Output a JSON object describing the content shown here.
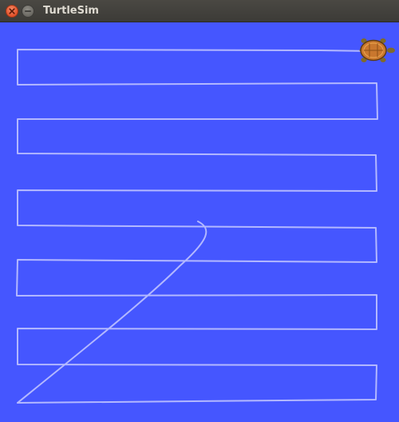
{
  "window": {
    "title": "TurtleSim"
  },
  "canvas": {
    "background_color": "#4556ff",
    "pen_color": "#b3b8ff",
    "turtle": {
      "name": "turtle-icon",
      "shell_color": "#c9772e",
      "pattern_color": "#e6a04c",
      "body_color": "#7f6a2a"
    }
  }
}
